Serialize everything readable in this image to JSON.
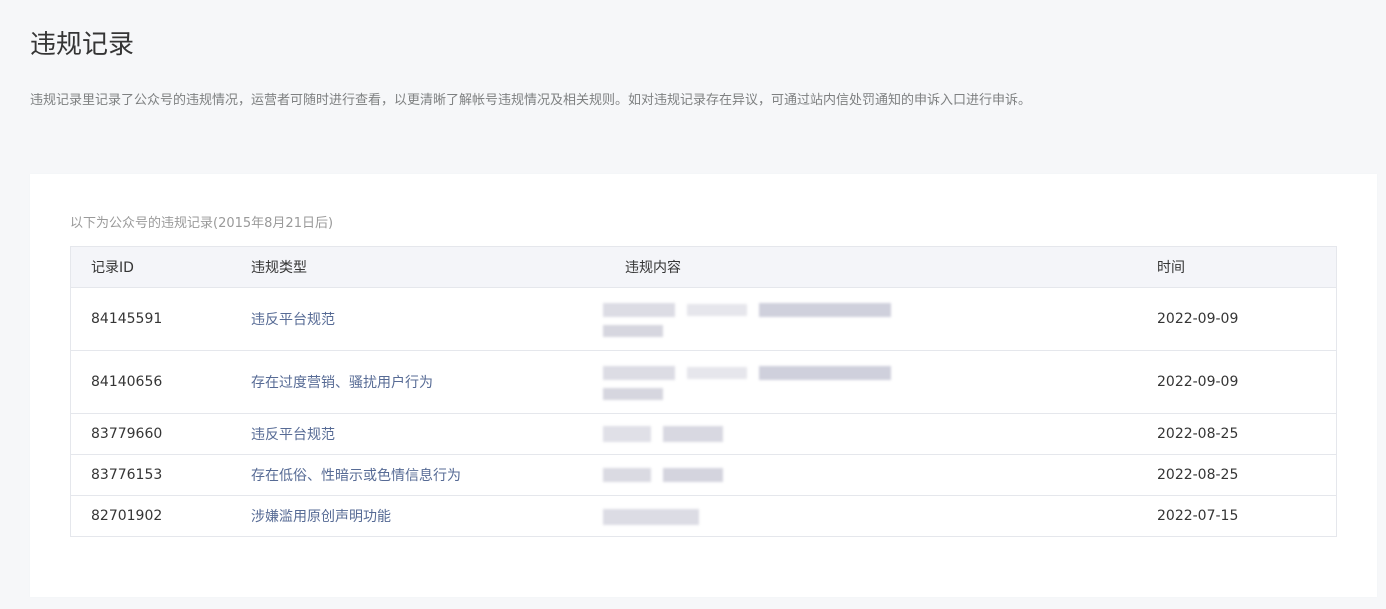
{
  "page": {
    "title": "违规记录",
    "description": "违规记录里记录了公众号的违规情况，运营者可随时进行查看，以更清晰了解帐号违规情况及相关规则。如对违规记录存在异议，可通过站内信处罚通知的申诉入口进行申诉。"
  },
  "records": {
    "caption": "以下为公众号的违规记录(2015年8月21日后)",
    "columns": {
      "id": "记录ID",
      "type": "违规类型",
      "content": "违规内容",
      "time": "时间"
    },
    "rows": [
      {
        "id": "84145591",
        "type": "违反平台规范",
        "time": "2022-09-09",
        "content_redacted": true
      },
      {
        "id": "84140656",
        "type": "存在过度营销、骚扰用户行为",
        "time": "2022-09-09",
        "content_redacted": true
      },
      {
        "id": "83779660",
        "type": "违反平台规范",
        "time": "2022-08-25",
        "content_redacted": true
      },
      {
        "id": "83776153",
        "type": "存在低俗、性暗示或色情信息行为",
        "time": "2022-08-25",
        "content_redacted": true
      },
      {
        "id": "82701902",
        "type": "涉嫌滥用原创声明功能",
        "time": "2022-07-15",
        "content_redacted": true
      }
    ]
  },
  "colors": {
    "link": "#576b95",
    "text": "#353535",
    "muted": "#7e8081",
    "header_bg": "#f4f5f9",
    "page_bg": "#f6f7f9"
  }
}
